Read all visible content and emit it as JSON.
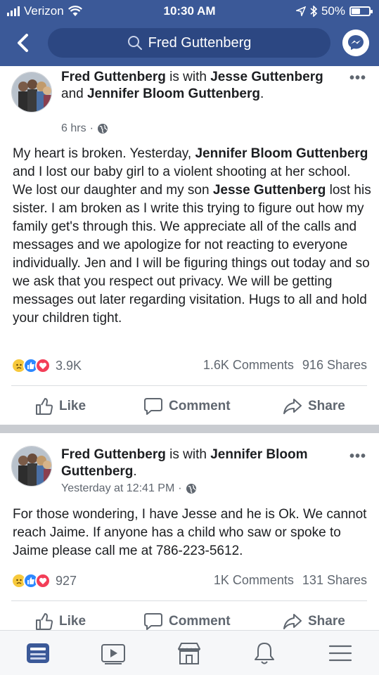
{
  "status_bar": {
    "carrier": "Verizon",
    "time": "10:30 AM",
    "battery": "50%",
    "battery_level": 0.5
  },
  "header": {
    "search_text": "Fred Guttenberg",
    "icons": [
      "back-chevron-icon",
      "search-icon",
      "messenger-icon"
    ]
  },
  "posts": [
    {
      "author": "Fred Guttenberg",
      "with_word": "is with",
      "tagged_1": "Jesse Guttenberg",
      "and_word": "and",
      "tagged_2": "Jennifer Bloom Guttenberg",
      "time": "6 hrs",
      "text": {
        "s1": "My heart is broken.  Yesterday, ",
        "b1": "Jennifer Bloom Guttenberg",
        "s2": " and I lost our baby girl to a violent shooting at her school.  We lost our daughter and my son ",
        "b2": "Jesse Guttenberg",
        "s3": " lost his sister.  I am broken as I write this trying to figure out how my family get's through this.  We appreciate all of the calls and messages and we apologize for not reacting to everyone individually.  Jen and I will be figuring things out today and so we ask that you respect out privacy.  We will be getting messages out later regarding visitation.  Hugs to all and hold your children tight."
      },
      "reactions": "3.9K",
      "comments": "1.6K Comments",
      "shares": "916 Shares"
    },
    {
      "author": "Fred Guttenberg",
      "with_word": "is with",
      "tagged_1": "Jennifer Bloom Guttenberg",
      "time": "Yesterday at 12:41 PM",
      "text": "For those wondering, I have Jesse and he is Ok.  We cannot reach Jaime.  If anyone has a child who saw or spoke to Jaime please call me at 786-223-5612.",
      "reactions": "927",
      "comments": "1K Comments",
      "shares": "131 Shares"
    }
  ],
  "actions": {
    "like": "Like",
    "comment": "Comment",
    "share": "Share"
  },
  "colors": {
    "brand": "#3b5998",
    "like": "#2d88ff",
    "love": "#f33e58",
    "sad": "#f7c93c"
  },
  "tabbar": [
    "news-feed-icon",
    "watch-icon",
    "marketplace-icon",
    "notifications-icon",
    "menu-icon"
  ]
}
